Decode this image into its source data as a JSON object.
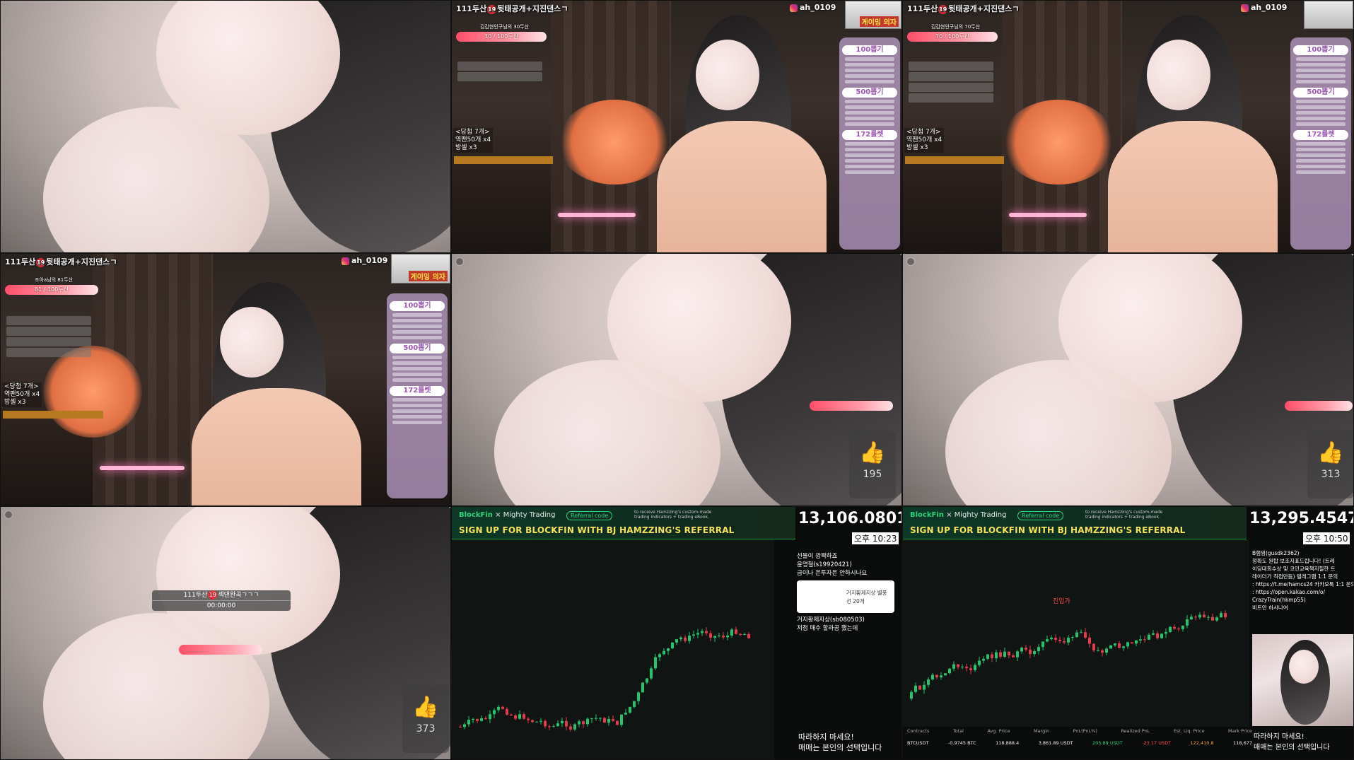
{
  "tiles": {
    "t1": {},
    "t2": {
      "room_title_pre": "111두산",
      "room_title_post": "뒷태공개+지진댄스ㄱ",
      "age": "19",
      "instagram": "ah_0109",
      "goal_caption": "김갑현인구님의 30두산",
      "goal_value": "30 / 100두산",
      "pick": [
        "<당첨 7개>",
        "역팬50개 x4",
        "방셀 x3"
      ],
      "menu": [
        "100뽑기",
        "500뽑기",
        "172룰렛"
      ],
      "corner_label": "게이밍 의자"
    },
    "t3": {
      "room_title_pre": "111두산",
      "room_title_post": "뒷태공개+지진댄스ㄱ",
      "age": "19",
      "instagram": "ah_0109",
      "goal_caption": "김갑현인구님의 70두산",
      "goal_value": "70 / 100두산",
      "pick": [
        "<당첨 7개>",
        "역팬50개 x4",
        "방셀 x3"
      ],
      "menu": [
        "100뽑기",
        "500뽑기",
        "172룰렛"
      ]
    },
    "t4": {
      "room_title_pre": "111두산",
      "room_title_post": "뒷태공개+지진댄스ㄱ",
      "age": "19",
      "instagram": "ah_0109",
      "goal_caption": "조아a님의 81두산",
      "goal_value": "81 / 100두산",
      "pick": [
        "<당첨 7개>",
        "역팬50개 x4",
        "방셀 x3"
      ],
      "menu": [
        "100뽑기",
        "500뽑기",
        "172룰렛"
      ],
      "corner_label": "게이밍 의자"
    },
    "t5": {
      "likes": "195"
    },
    "t6": {
      "likes": "313"
    },
    "t7": {
      "timer_title_pre": "111두산",
      "age": "19",
      "timer_title_post": "섹댄완곡ㄱㄱㄱ",
      "timer_value": "00:00:00",
      "likes": "373"
    },
    "t8": {
      "brand": "BlockFin",
      "partner": "Mighty Trading",
      "ref": "Referral code",
      "small": "to receive Hamzzing's custom-made trading indicators + trading eBook.",
      "headline": "SIGN UP FOR BLOCKFIN WITH BJ HAMZZING'S REFERRAL",
      "price": "13,106.0801",
      "clock": "오후 10:23",
      "chat": [
        "선물이 깜짝하죠",
        "윤명철(s19920421)",
        "금이나 은투자은 안하시나요"
      ],
      "donation": "거지황제지상 별풍선 20개",
      "chat2": [
        "거지황제지상(sb080503)",
        "저점 매수 할라공 했는데"
      ],
      "note": [
        "따라하지 마세요!",
        "매매는 본인의 선택입니다"
      ]
    },
    "t9": {
      "brand": "BlockFin",
      "partner": "Mighty Trading",
      "ref": "Referral code",
      "small": "to receive Hamzzing's custom-made trading indicators + trading eBook.",
      "headline": "SIGN UP FOR BLOCKFIN WITH BJ HAMZZING'S REFERRAL",
      "price": "13,295.4547",
      "clock": "오후 10:50",
      "entry_label": "진입가",
      "chat": [
        "B햄찡(gusdk2362)",
        "정확도 원탑 보조지표드립니다! (트레",
        "이딩대회수상 및 코인교육책지필한 트",
        "레이더가 직접만듬) 텔레그램 1:1 문의",
        ": https://t.me/hamcs24 카카오톡 1:1 문의",
        ": https://open.kakao.com/o/",
        "CrazyTrain(hkmp55)",
        "비트만 하시나여"
      ],
      "positions_header": [
        "Contracts",
        "Total",
        "Avg. Price",
        "Margin",
        "PnL(PnL%)",
        "Realized PnL",
        "Est. Liq. Price",
        "Mark Price"
      ],
      "positions_row": [
        "BTCUSDT",
        "-0.9745 BTC",
        "118,888.4",
        "3,861.89 USDT",
        "205.89 USDT",
        "-23.17 USDT",
        "122,410.8",
        "118,677"
      ],
      "note": [
        "따라하지 마세요!",
        "매매는 본인의 선택입니다"
      ]
    }
  }
}
